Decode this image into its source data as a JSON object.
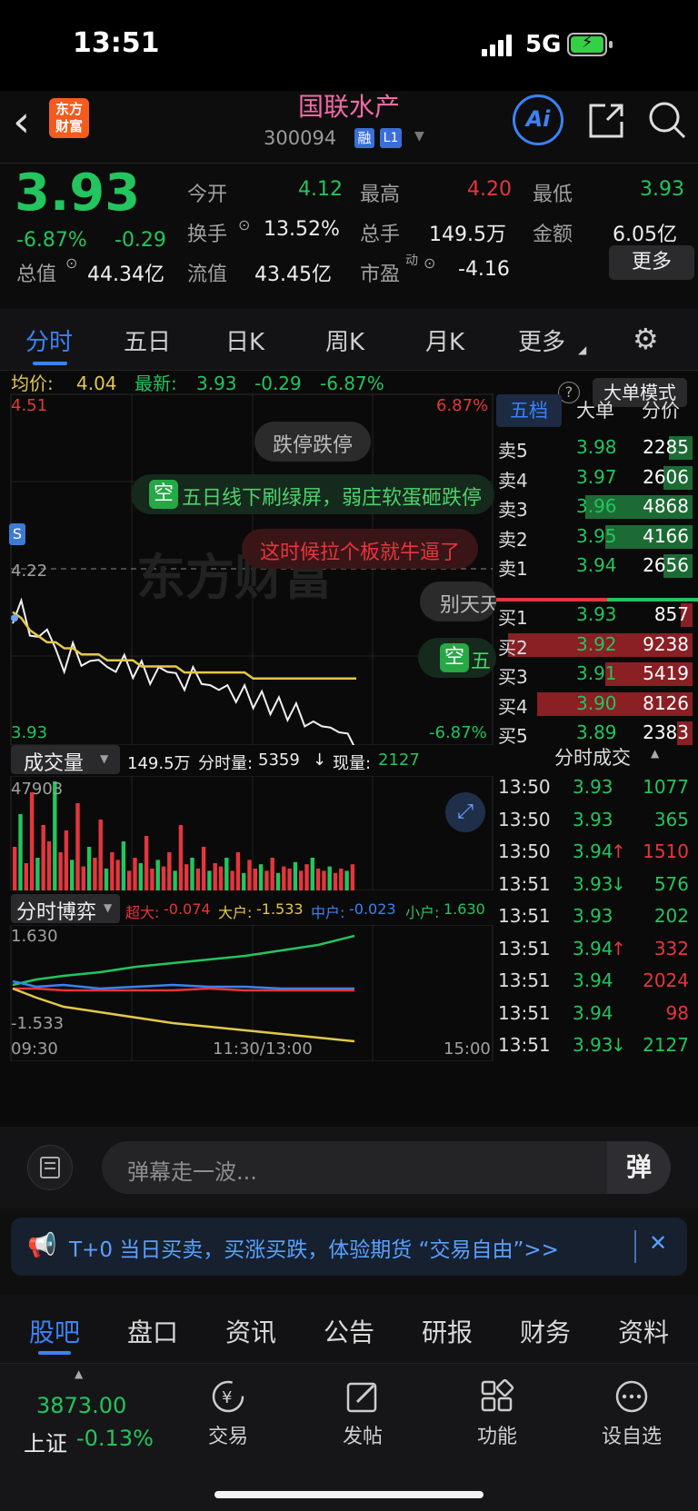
{
  "status": {
    "time": "13:51",
    "network": "5G"
  },
  "header": {
    "back": "‹",
    "logo_line1": "东方",
    "logo_line2": "财富",
    "name": "国联水产",
    "code": "300094",
    "badge_rong": "融",
    "badge_l1": "L1",
    "ai": "Ai"
  },
  "quote": {
    "price": "3.93",
    "pct": "-6.87%",
    "chg": "-0.29",
    "open_label": "今开",
    "open": "4.12",
    "high_label": "最高",
    "high": "4.20",
    "low_label": "最低",
    "low": "3.93",
    "turnover_label": "换手",
    "turnover": "13.52%",
    "vol_label": "总手",
    "vol": "149.5万",
    "amount_label": "金额",
    "amount": "6.05亿",
    "mcap_label": "总值",
    "mcap": "44.34亿",
    "float_label": "流值",
    "float": "43.45亿",
    "pe_label": "市盈",
    "pe_sup": "动",
    "pe": "-4.16",
    "more": "更多"
  },
  "tabs": [
    "分时",
    "五日",
    "日K",
    "周K",
    "月K",
    "更多"
  ],
  "info": {
    "avg_label": "均价:",
    "avg": "4.04",
    "last_label": "最新:",
    "last": "3.93",
    "chg": "-0.29",
    "pct": "-6.87%",
    "help": "?",
    "mode": "大单模式"
  },
  "chart": {
    "top_price": "4.51",
    "top_pct": "6.87%",
    "mid_price": "4.22",
    "bot_price": "3.93",
    "bot_pct": "-6.87%",
    "s_marker": "S",
    "watermark": "东方财富",
    "bubbles": [
      "跌停跌停",
      "五日线下刷绿屏，弱庄软蛋砸跌停",
      "这时候拉个板就牛逼了",
      "别天天",
      "五"
    ],
    "empty_tag": "空"
  },
  "chart_data": {
    "type": "line",
    "price_range": [
      3.93,
      4.51
    ],
    "prev_close": 4.22,
    "x_labels": [
      "09:30",
      "11:30/13:00",
      "15:00"
    ],
    "series": [
      {
        "name": "最新",
        "values": [
          4.14,
          4.16,
          4.12,
          4.1,
          4.13,
          4.08,
          4.06,
          4.09,
          4.07,
          4.06,
          4.08,
          4.05,
          4.06,
          4.07,
          4.05,
          4.06,
          4.04,
          4.05,
          4.06,
          4.04,
          4.03,
          4.05,
          4.04,
          4.02,
          4.03,
          4.02,
          4.01,
          4.02,
          4.0,
          4.01,
          3.99,
          4.0,
          3.98,
          3.99,
          3.97,
          3.96,
          3.97,
          3.95,
          3.96,
          3.94,
          3.93
        ]
      },
      {
        "name": "均价",
        "values": [
          4.15,
          4.14,
          4.12,
          4.11,
          4.1,
          4.1,
          4.09,
          4.09,
          4.08,
          4.08,
          4.08,
          4.07,
          4.07,
          4.07,
          4.07,
          4.06,
          4.06,
          4.06,
          4.06,
          4.06,
          4.05,
          4.05,
          4.05,
          4.05,
          4.05,
          4.05,
          4.05,
          4.05,
          4.04,
          4.04,
          4.04,
          4.04,
          4.04,
          4.04,
          4.04,
          4.04,
          4.04,
          4.04,
          4.04,
          4.04,
          4.04
        ]
      }
    ]
  },
  "volume": {
    "label": "成交量",
    "total": "149.5万",
    "fen_label": "分时量:",
    "fen": "5359",
    "arrow": "↓",
    "now_label": "现量:",
    "now": "2127",
    "max": "47903"
  },
  "volume_bars": [
    40,
    70,
    25,
    90,
    30,
    60,
    45,
    100,
    35,
    55,
    28,
    80,
    22,
    40,
    30,
    65,
    20,
    35,
    28,
    45,
    18,
    30,
    25,
    50,
    20,
    28,
    22,
    35,
    18,
    60,
    24,
    30,
    20,
    40,
    18,
    25,
    22,
    30,
    18,
    35,
    16,
    28,
    20,
    24,
    18,
    30,
    16,
    22,
    20,
    26,
    18,
    24,
    30,
    20,
    18,
    22,
    16,
    20,
    18,
    24
  ],
  "bout": {
    "label": "分时博弈",
    "super_label": "超大:",
    "super": "-0.074",
    "big_label": "大户:",
    "big": "-1.533",
    "mid_label": "中户:",
    "mid": "-0.023",
    "small_label": "小户:",
    "small": "1.630",
    "top": "1.630",
    "bot": "-1.533",
    "x0": "09:30",
    "x1": "11:30/13:00",
    "x2": "15:00"
  },
  "orderbook": {
    "tabs": [
      "五档",
      "大单",
      "分价"
    ],
    "sells": [
      {
        "label": "卖5",
        "price": "3.98",
        "vol": "2285",
        "bar": 0.12
      },
      {
        "label": "卖4",
        "price": "3.97",
        "vol": "2606",
        "bar": 0.15
      },
      {
        "label": "卖3",
        "price": "3.96",
        "vol": "4868",
        "bar": 0.55
      },
      {
        "label": "卖2",
        "price": "3.95",
        "vol": "4166",
        "bar": 0.45
      },
      {
        "label": "卖1",
        "price": "3.94",
        "vol": "2656",
        "bar": 0.15
      }
    ],
    "buys": [
      {
        "label": "买1",
        "price": "3.93",
        "vol": "857",
        "bar": 0.06
      },
      {
        "label": "买2",
        "price": "3.92",
        "vol": "9238",
        "bar": 0.95
      },
      {
        "label": "买3",
        "price": "3.91",
        "vol": "5419",
        "bar": 0.45
      },
      {
        "label": "买4",
        "price": "3.90",
        "vol": "8126",
        "bar": 0.8
      },
      {
        "label": "买5",
        "price": "3.89",
        "vol": "2383",
        "bar": 0.08
      }
    ]
  },
  "trades": {
    "title": "分时成交",
    "rows": [
      {
        "time": "13:50",
        "price": "3.93",
        "arrow": "",
        "vol": "1077",
        "color": "g"
      },
      {
        "time": "13:50",
        "price": "3.93",
        "arrow": "",
        "vol": "365",
        "color": "g"
      },
      {
        "time": "13:50",
        "price": "3.94",
        "arrow": "↑",
        "vol": "1510",
        "color": "r"
      },
      {
        "time": "13:51",
        "price": "3.93",
        "arrow": "↓",
        "vol": "576",
        "color": "g"
      },
      {
        "time": "13:51",
        "price": "3.93",
        "arrow": "",
        "vol": "202",
        "color": "g"
      },
      {
        "time": "13:51",
        "price": "3.94",
        "arrow": "↑",
        "vol": "332",
        "color": "r"
      },
      {
        "time": "13:51",
        "price": "3.94",
        "arrow": "",
        "vol": "2024",
        "color": "r"
      },
      {
        "time": "13:51",
        "price": "3.94",
        "arrow": "",
        "vol": "98",
        "color": "r"
      },
      {
        "time": "13:51",
        "price": "3.93",
        "arrow": "↓",
        "vol": "2127",
        "color": "g"
      }
    ]
  },
  "danmu": {
    "placeholder": "弹幕走一波...",
    "btn": "弹"
  },
  "ad": {
    "text": "T+0 当日买卖，买涨买跌，体验期货 “交易自由”>>",
    "close": "✕"
  },
  "bottom_tabs": [
    "股吧",
    "盘口",
    "资讯",
    "公告",
    "研报",
    "财务",
    "资料"
  ],
  "nav": {
    "index_value": "3873.00",
    "index_name": "上证",
    "index_pct": "-0.13%",
    "items": [
      "交易",
      "发帖",
      "功能",
      "设自选"
    ]
  },
  "colors": {
    "up": "#e5363d",
    "down": "#22c55e",
    "avg": "#e3c84a",
    "accent": "#3b82f6"
  }
}
